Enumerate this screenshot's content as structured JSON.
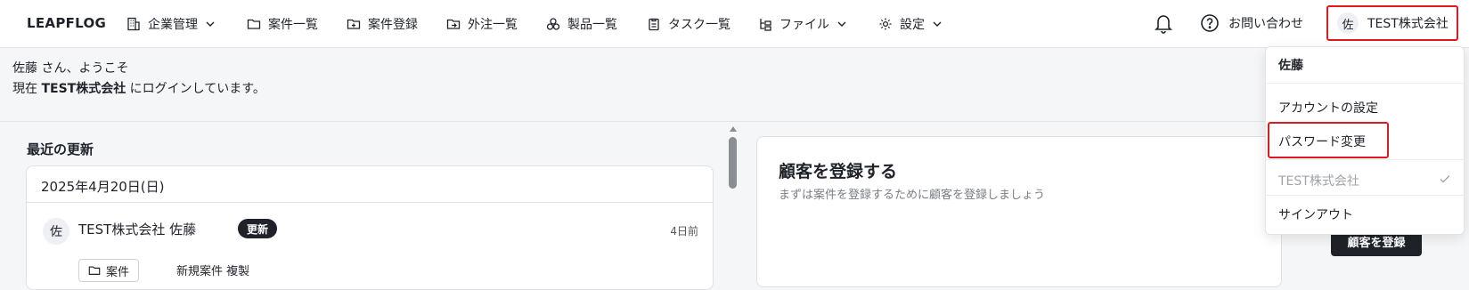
{
  "brand": "LEAPFLOG",
  "nav": {
    "company": "企業管理",
    "projects": "案件一覧",
    "register_project": "案件登録",
    "outsourcing": "外注一覧",
    "products": "製品一覧",
    "tasks": "タスク一覧",
    "files": "ファイル",
    "settings": "設定"
  },
  "header": {
    "contact": "お問い合わせ",
    "account_initial": "佐",
    "account_name": "TEST株式会社"
  },
  "welcome": {
    "line1": "佐藤 さん、ようこそ",
    "line2_prefix": "現在 ",
    "line2_company": "TEST株式会社",
    "line2_suffix": " にログインしています。"
  },
  "recent": {
    "title": "最近の更新",
    "date": "2025年4月20日(日)",
    "entry": {
      "initial": "佐",
      "name": "TEST株式会社  佐藤",
      "badge": "更新",
      "time": "4日前",
      "tag": "案件",
      "detail": "新規案件  複製"
    }
  },
  "cta": {
    "title": "顧客を登録する",
    "subtitle": "まずは案件を登録するために顧客を登録しましょう",
    "button": "顧客を登録"
  },
  "dropdown": {
    "user": "佐藤",
    "account_settings": "アカウントの設定",
    "password_change": "パスワード変更",
    "company": "TEST株式会社",
    "signout": "サインアウト"
  },
  "colors": {
    "highlight": "#e0181f",
    "primary_dark": "#1f2329"
  }
}
